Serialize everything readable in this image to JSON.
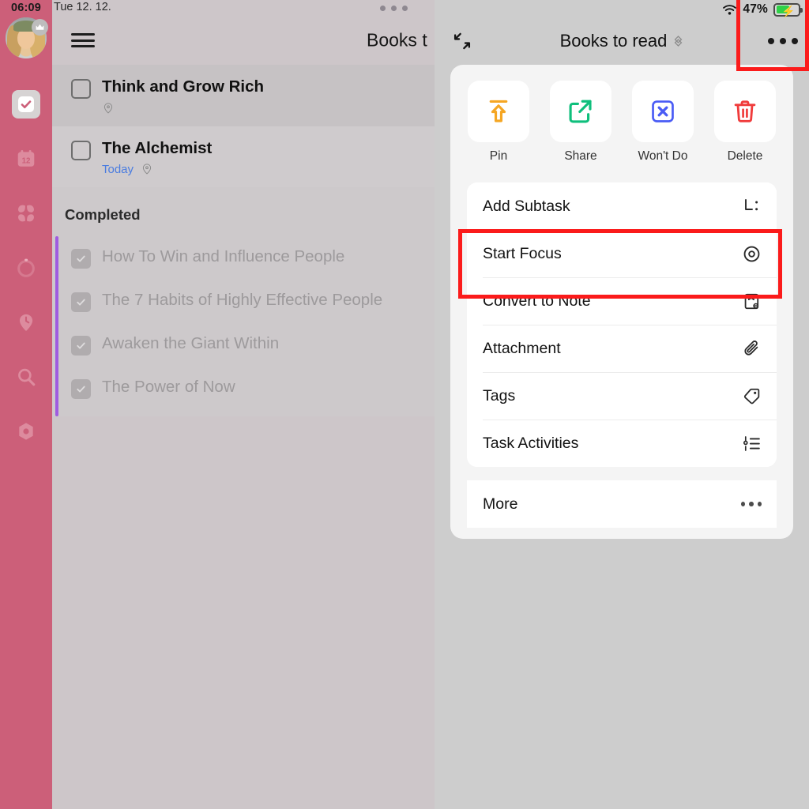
{
  "status_bar": {
    "time": "06:09",
    "date": "Tue 12. 12.",
    "battery_percent": "47%",
    "wifi_icon": "wifi-icon",
    "battery_icon": "battery-charging-icon",
    "dots_icon": "ellipsis-icon"
  },
  "sidebar": {
    "avatar": "user-avatar",
    "badge_icon": "crown-icon",
    "accent_color": "#cc5f79",
    "items": [
      {
        "name": "sidebar-item-tasks",
        "icon": "check-square-icon",
        "active": true
      },
      {
        "name": "sidebar-item-calendar",
        "icon": "calendar-12-icon",
        "active": false
      },
      {
        "name": "sidebar-item-matrix",
        "icon": "four-squares-icon",
        "active": false
      },
      {
        "name": "sidebar-item-pomodoro",
        "icon": "timer-ring-icon",
        "active": false
      },
      {
        "name": "sidebar-item-habit",
        "icon": "clock-pin-icon",
        "active": false
      },
      {
        "name": "sidebar-item-search",
        "icon": "search-icon",
        "active": false
      },
      {
        "name": "sidebar-item-settings",
        "icon": "hexagon-gear-icon",
        "active": false
      }
    ]
  },
  "list_panel": {
    "menu_icon": "hamburger-icon",
    "title": "Books t",
    "tasks": [
      {
        "title": "Think and Grow Rich",
        "date": "",
        "pin_icon": "location-pin-icon",
        "checked": false
      },
      {
        "title": "The Alchemist",
        "date": "Today",
        "pin_icon": "location-pin-icon",
        "checked": false
      }
    ],
    "completed_header": "Completed",
    "completed": [
      {
        "title": "How To Win and Influence People",
        "checked": true
      },
      {
        "title": "The 7 Habits of Highly Effective People",
        "checked": true
      },
      {
        "title": "Awaken the Giant Within",
        "checked": true
      },
      {
        "title": "The Power of Now",
        "checked": true
      }
    ],
    "accent_color": "#a05ce0",
    "date_color": "#4a7ce0"
  },
  "detail_panel": {
    "expand_icon": "collapse-diagonal-icon",
    "title": "Books to read",
    "title_chevron_icon": "chevron-updown-icon",
    "more_icon": "ellipsis-icon"
  },
  "action_sheet": {
    "quick_actions": [
      {
        "label": "Pin",
        "icon": "pin-arrow-up-icon",
        "color": "#f5a623"
      },
      {
        "label": "Share",
        "icon": "share-external-icon",
        "color": "#0fbf7c"
      },
      {
        "label": "Won't Do",
        "icon": "x-square-icon",
        "color": "#4a5cf5"
      },
      {
        "label": "Delete",
        "icon": "trash-icon",
        "color": "#f03b3b"
      }
    ],
    "menu_items": [
      {
        "label": "Add Subtask",
        "icon": "subtask-icon",
        "highlighted": false
      },
      {
        "label": "Start Focus",
        "icon": "focus-target-icon",
        "highlighted": true
      },
      {
        "label": "Convert to Note",
        "icon": "note-convert-icon",
        "highlighted": false
      },
      {
        "label": "Attachment",
        "icon": "paperclip-icon",
        "highlighted": false
      },
      {
        "label": "Tags",
        "icon": "tag-icon",
        "highlighted": false
      },
      {
        "label": "Task Activities",
        "icon": "activity-list-icon",
        "highlighted": false
      }
    ],
    "more": {
      "label": "More",
      "icon": "ellipsis-icon"
    }
  },
  "annotations": {
    "highlight_color": "#fb1b1b",
    "boxes": [
      {
        "name": "highlight-start-focus"
      },
      {
        "name": "highlight-more-button"
      }
    ]
  }
}
